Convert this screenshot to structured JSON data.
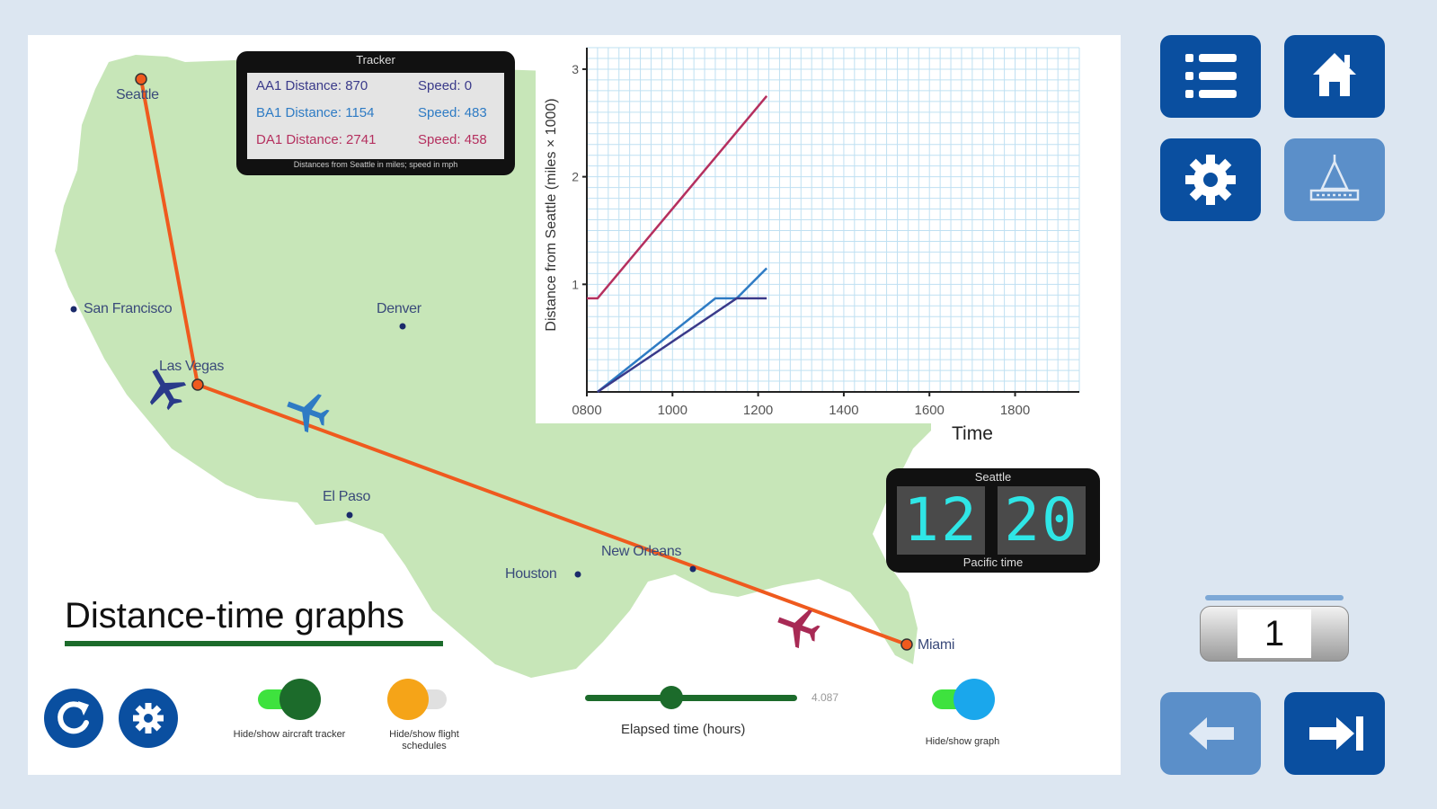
{
  "cities": {
    "seattle": "Seattle",
    "san_francisco": "San Francisco",
    "denver": "Denver",
    "las_vegas": "Las Vegas",
    "el_paso": "El Paso",
    "houston": "Houston",
    "new_orleans": "New Orleans",
    "miami": "Miami"
  },
  "tracker": {
    "title": "Tracker",
    "rows": [
      {
        "distance": "AA1 Distance: 870",
        "speed": "Speed: 0",
        "color": "#3a3a8a"
      },
      {
        "distance": "BA1 Distance: 1154",
        "speed": "Speed: 483",
        "color": "#2e7bc4"
      },
      {
        "distance": "DA1 Distance: 2741",
        "speed": "Speed: 458",
        "color": "#b5305f"
      }
    ],
    "footnote": "Distances from Seattle in miles; speed in mph"
  },
  "chart_data": {
    "type": "line",
    "ylabel": "Distance from Seattle (miles × 1000)",
    "xlabel": "Time",
    "x_ticks": [
      "0800",
      "1000",
      "1200",
      "1400",
      "1600",
      "1800"
    ],
    "y_ticks": [
      "1",
      "2",
      "3"
    ],
    "xlim": [
      800,
      1950
    ],
    "ylim": [
      0,
      3.2
    ],
    "grid": true,
    "series": [
      {
        "color": "#b5305f",
        "points": [
          [
            800,
            0.87
          ],
          [
            825,
            0.87
          ],
          [
            1220,
            2.75
          ]
        ]
      },
      {
        "color": "#2e7bc4",
        "points": [
          [
            825,
            0
          ],
          [
            1100,
            0.87
          ],
          [
            1150,
            0.87
          ],
          [
            1220,
            1.15
          ]
        ]
      },
      {
        "color": "#3a3a8a",
        "points": [
          [
            825,
            0
          ],
          [
            1150,
            0.87
          ],
          [
            1220,
            0.87
          ]
        ]
      }
    ]
  },
  "clock": {
    "top": "Seattle",
    "hours": "12",
    "minutes": "20",
    "bottom": "Pacific time"
  },
  "title": "Distance-time graphs",
  "controls": {
    "tracker_toggle_label": "Hide/show aircraft tracker",
    "schedule_toggle_label": "Hide/show flight schedules",
    "graph_toggle_label": "Hide/show graph",
    "slider_label": "Elapsed time (hours)",
    "slider_value": "4.087",
    "slider_fraction": 0.35
  },
  "pager": {
    "page": "1"
  },
  "colors": {
    "land": "#c7e6b8",
    "route": "#ef5a1e",
    "button_dark": "#0a4fa0",
    "button_light": "#5b8fc9",
    "toggle_green": "#1c6b2b",
    "toggle_orange": "#f5a418",
    "toggle_blue": "#1aa7ec"
  },
  "icons": {
    "menu": "list-icon",
    "home": "home-icon",
    "settings": "gear-icon",
    "weighing": "scale-icon",
    "reset": "refresh-icon",
    "back": "arrow-left-icon",
    "forward": "arrow-right-end-icon"
  }
}
